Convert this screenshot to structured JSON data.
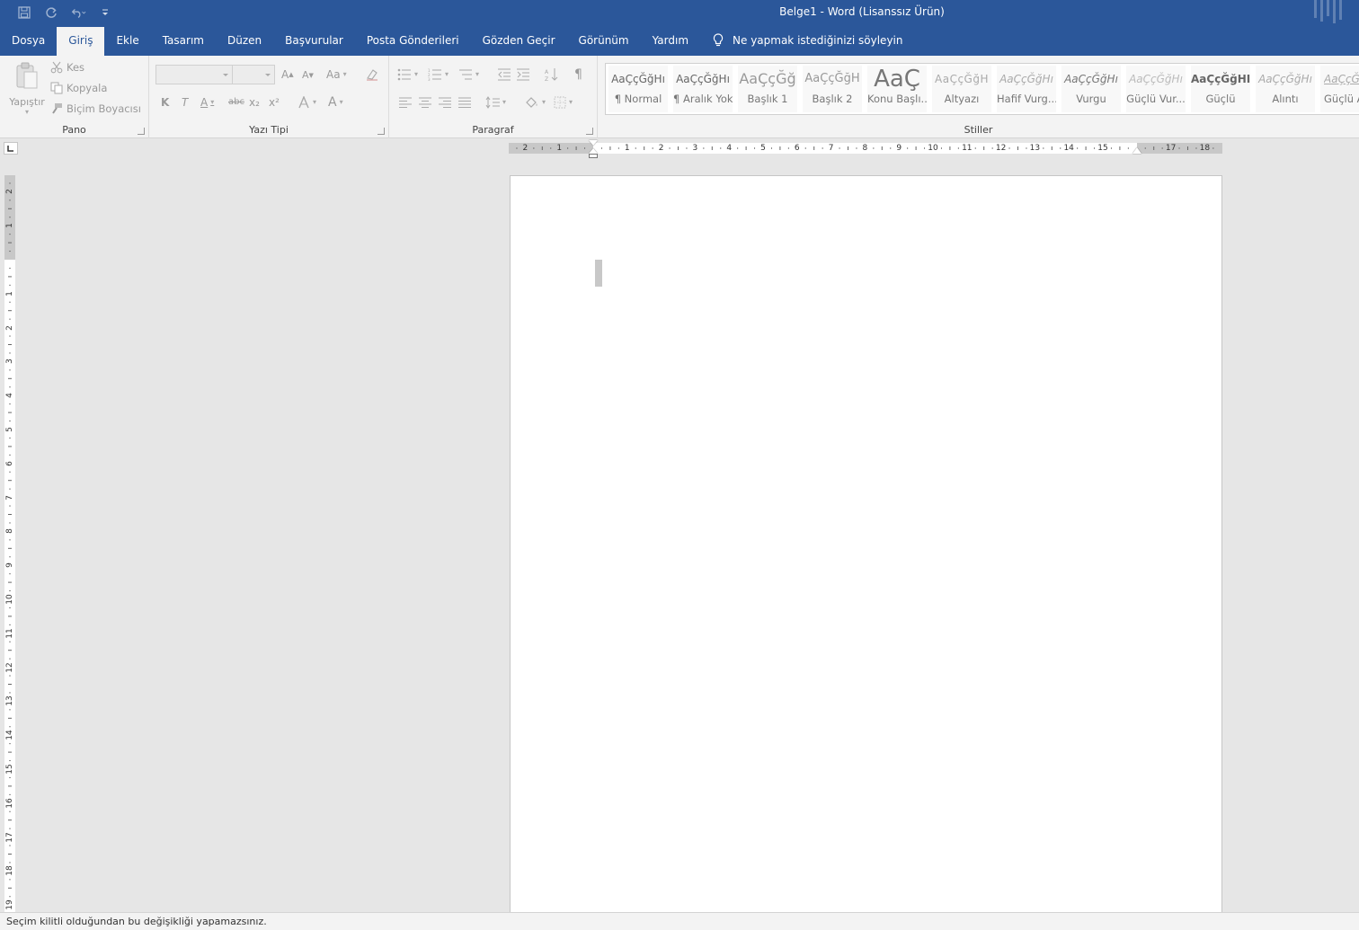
{
  "window": {
    "title": "Belge1  -  Word (Lisanssız Ürün)"
  },
  "quick_access": {
    "icons": [
      "save-icon",
      "redo-icon",
      "undo-icon",
      "customize-icon"
    ]
  },
  "tabs": [
    {
      "label": "Dosya"
    },
    {
      "label": "Giriş",
      "active": true
    },
    {
      "label": "Ekle"
    },
    {
      "label": "Tasarım"
    },
    {
      "label": "Düzen"
    },
    {
      "label": "Başvurular"
    },
    {
      "label": "Posta Gönderileri"
    },
    {
      "label": "Gözden Geçir"
    },
    {
      "label": "Görünüm"
    },
    {
      "label": "Yardım"
    }
  ],
  "tellme": {
    "label": "Ne yapmak istediğinizi söyleyin"
  },
  "clipboard": {
    "group_label": "Pano",
    "paste": "Yapıştır",
    "cut": "Kes",
    "copy": "Kopyala",
    "format_painter": "Biçim Boyacısı"
  },
  "font": {
    "group_label": "Yazı Tipi",
    "font_name": "",
    "font_size": "",
    "bold": "K",
    "italic": "T",
    "underline": "A",
    "strikethrough": "abc",
    "subscript": "x₂",
    "superscript": "x²",
    "font_color": "A",
    "change_case": "Aa"
  },
  "paragraph": {
    "group_label": "Paragraf",
    "pilcrow": "¶"
  },
  "styles": {
    "group_label": "Stiller",
    "items": [
      {
        "sample": "AaÇçĞğHı",
        "name": "¶ Normal"
      },
      {
        "sample": "AaÇçĞğHı",
        "name": "¶ Aralık Yok"
      },
      {
        "sample": "AaÇçĞğ",
        "name": "Başlık 1"
      },
      {
        "sample": "AaÇçĞğH",
        "name": "Başlık 2"
      },
      {
        "sample": "AaÇ",
        "name": "Konu Başlı..."
      },
      {
        "sample": "AaÇçĞğH",
        "name": "Altyazı"
      },
      {
        "sample": "AaÇçĞğHı",
        "name": "Hafif Vurg..."
      },
      {
        "sample": "AaÇçĞğHı",
        "name": "Vurgu"
      },
      {
        "sample": "AaÇçĞğHı",
        "name": "Güçlü Vur..."
      },
      {
        "sample": "AaÇçĞğHI",
        "name": "Güçlü"
      },
      {
        "sample": "AaÇçĞğHı",
        "name": "Alıntı"
      },
      {
        "sample": "AaÇçĞ",
        "name": "Güçlü A"
      }
    ]
  },
  "hruler": {
    "labels": [
      "2",
      "1",
      "1",
      "2",
      "3",
      "4",
      "5",
      "6",
      "7",
      "8",
      "9",
      "10",
      "11",
      "12",
      "13",
      "14",
      "15",
      "17",
      "18"
    ]
  },
  "vruler": {
    "labels": [
      "2",
      "1",
      "1",
      "2",
      "3",
      "4",
      "5",
      "6",
      "7",
      "8",
      "9",
      "10",
      "11",
      "12",
      "13",
      "14",
      "15",
      "16",
      "17",
      "18",
      "19"
    ]
  },
  "status": {
    "message": "Seçim kilitli olduğundan bu değişikliği yapamazsınız."
  }
}
